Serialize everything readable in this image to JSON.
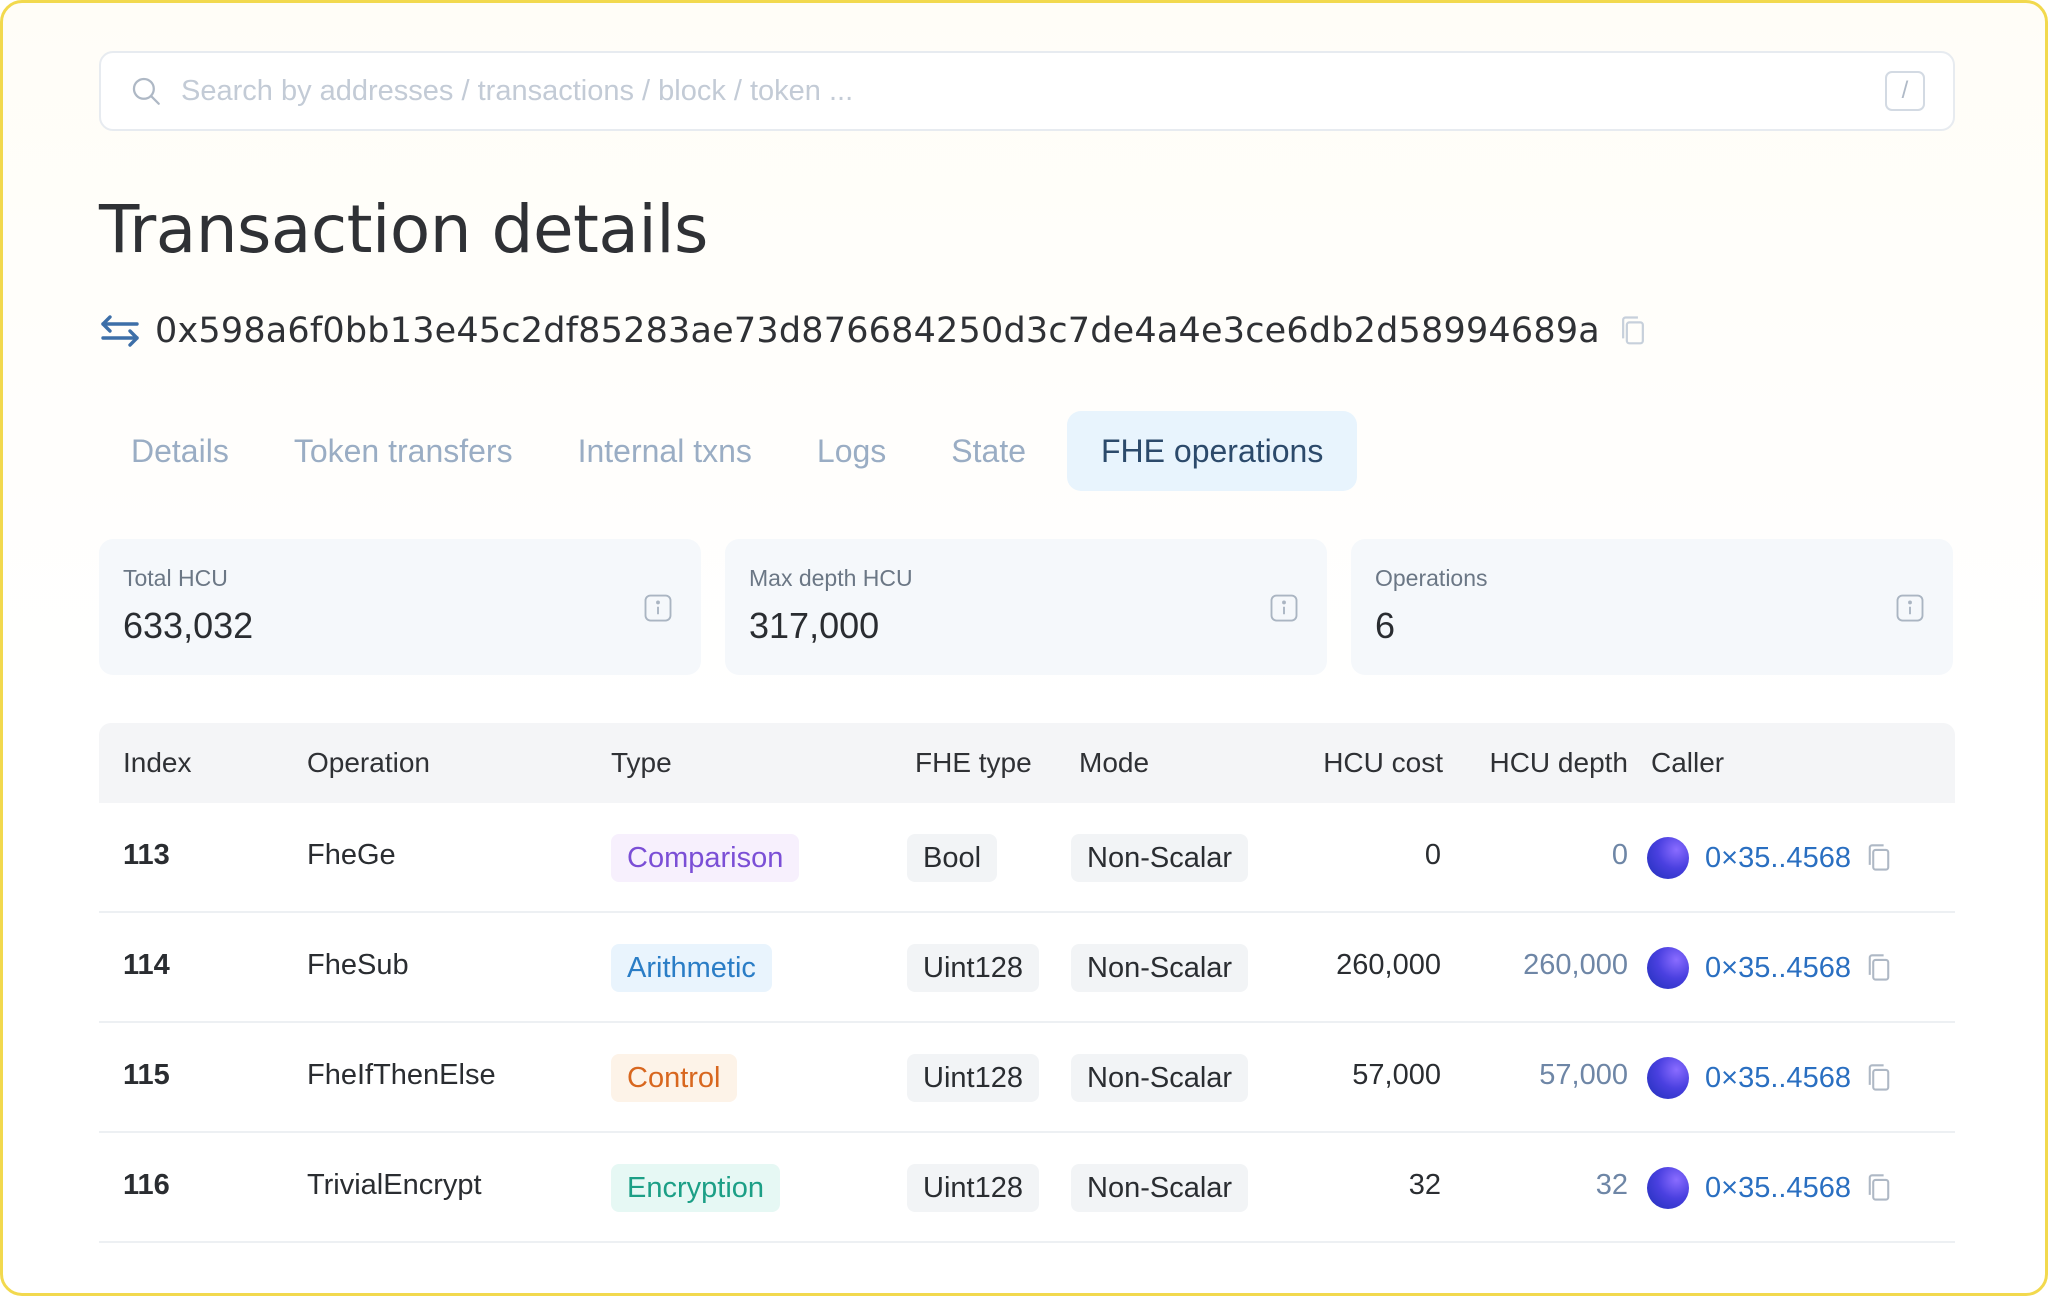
{
  "search": {
    "placeholder": "Search by addresses / transactions / block / token ...",
    "shortcut": "/"
  },
  "page": {
    "title": "Transaction details",
    "tx_hash": "0x598a6f0bb13e45c2df85283ae73d876684250d3c7de4a4e3ce6db2d58994689a"
  },
  "tabs": [
    {
      "label": "Details"
    },
    {
      "label": "Token transfers"
    },
    {
      "label": "Internal txns"
    },
    {
      "label": "Logs"
    },
    {
      "label": "State"
    },
    {
      "label": "FHE operations",
      "active": true
    }
  ],
  "stats": [
    {
      "label": "Total HCU",
      "value": "633,032"
    },
    {
      "label": "Max depth HCU",
      "value": "317,000"
    },
    {
      "label": "Operations",
      "value": "6"
    }
  ],
  "table": {
    "headers": {
      "index": "Index",
      "operation": "Operation",
      "type": "Type",
      "fhe_type": "FHE type",
      "mode": "Mode",
      "hcu_cost": "HCU cost",
      "hcu_depth": "HCU depth",
      "caller": "Caller"
    },
    "rows": [
      {
        "index": "113",
        "operation": "FheGe",
        "type": "Comparison",
        "fhe_type": "Bool",
        "mode": "Non-Scalar",
        "hcu_cost": "0",
        "hcu_depth": "0",
        "caller": "0×35..4568"
      },
      {
        "index": "114",
        "operation": "FheSub",
        "type": "Arithmetic",
        "fhe_type": "Uint128",
        "mode": "Non-Scalar",
        "hcu_cost": "260,000",
        "hcu_depth": "260,000",
        "caller": "0×35..4568"
      },
      {
        "index": "115",
        "operation": "FheIfThenElse",
        "type": "Control",
        "fhe_type": "Uint128",
        "mode": "Non-Scalar",
        "hcu_cost": "57,000",
        "hcu_depth": "57,000",
        "caller": "0×35..4568"
      },
      {
        "index": "116",
        "operation": "TrivialEncrypt",
        "type": "Encryption",
        "fhe_type": "Uint128",
        "mode": "Non-Scalar",
        "hcu_cost": "32",
        "hcu_depth": "32",
        "caller": "0×35..4568"
      }
    ]
  },
  "type_colors": {
    "Comparison": {
      "bg": "#f7f0fd",
      "fg": "#7b4fd6"
    },
    "Arithmetic": {
      "bg": "#e9f4fd",
      "fg": "#2a7dc6"
    },
    "Control": {
      "bg": "#fdf3e8",
      "fg": "#d8671f"
    },
    "Encryption": {
      "bg": "#e6f8f4",
      "fg": "#1c9f86"
    }
  },
  "colors": {
    "accent_link": "#2a6fc1",
    "frame_border": "#f2d94e",
    "active_tab_bg": "#e8f4fd",
    "depth_text": "#6e86a6"
  },
  "icons": {
    "search": "search-icon",
    "tx": "arrows-swap-icon",
    "copy": "copy-icon",
    "info": "info-icon"
  }
}
